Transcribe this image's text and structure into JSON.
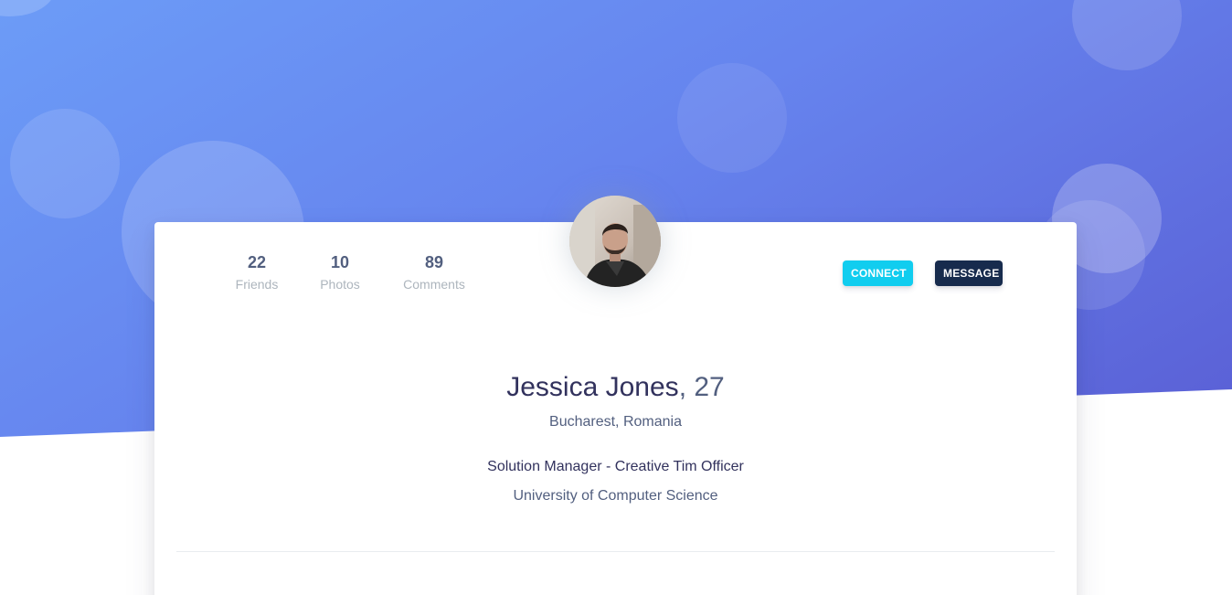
{
  "profile": {
    "name": "Jessica Jones",
    "age": ", 27",
    "location": "Bucharest, Romania",
    "job": "Solution Manager - Creative Tim Officer",
    "school": "University of Computer Science"
  },
  "stats": [
    {
      "value": "22",
      "label": "Friends"
    },
    {
      "value": "10",
      "label": "Photos"
    },
    {
      "value": "89",
      "label": "Comments"
    }
  ],
  "actions": {
    "connect_label": "CONNECT",
    "message_label": "MESSAGE"
  },
  "colors": {
    "connect": "#11cdef",
    "message": "#172b4d",
    "heading": "#32325d"
  },
  "icons": {
    "avatar": "user-photo"
  }
}
